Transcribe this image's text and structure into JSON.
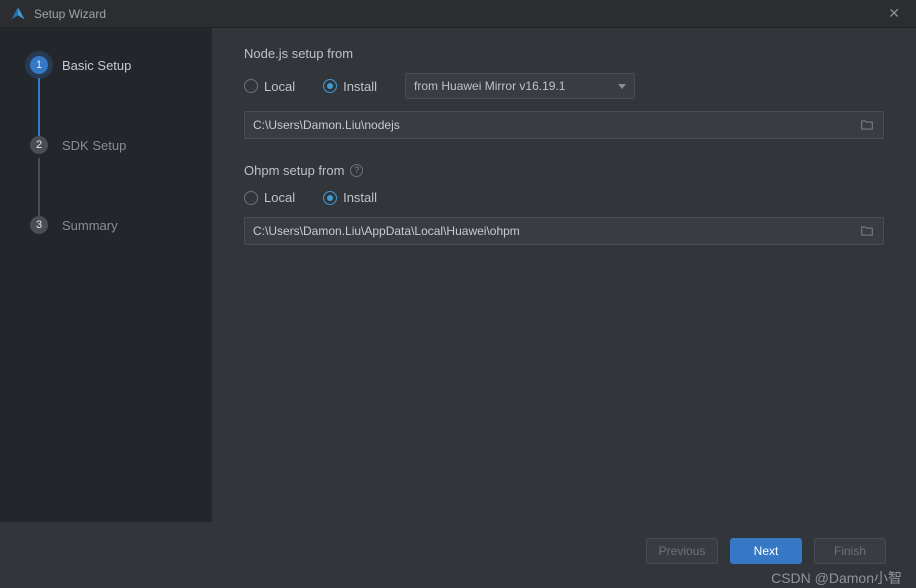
{
  "window": {
    "title": "Setup Wizard"
  },
  "sidebar": {
    "steps": [
      {
        "num": "1",
        "label": "Basic Setup"
      },
      {
        "num": "2",
        "label": "SDK Setup"
      },
      {
        "num": "3",
        "label": "Summary"
      }
    ]
  },
  "content": {
    "node": {
      "title": "Node.js setup from",
      "local_label": "Local",
      "install_label": "Install",
      "dropdown": "from Huawei Mirror v16.19.1",
      "path": "C:\\Users\\Damon.Liu\\nodejs"
    },
    "ohpm": {
      "title": "Ohpm setup from",
      "local_label": "Local",
      "install_label": "Install",
      "path": "C:\\Users\\Damon.Liu\\AppData\\Local\\Huawei\\ohpm"
    }
  },
  "footer": {
    "previous": "Previous",
    "next": "Next",
    "finish": "Finish"
  },
  "watermark": "CSDN @Damon小智"
}
